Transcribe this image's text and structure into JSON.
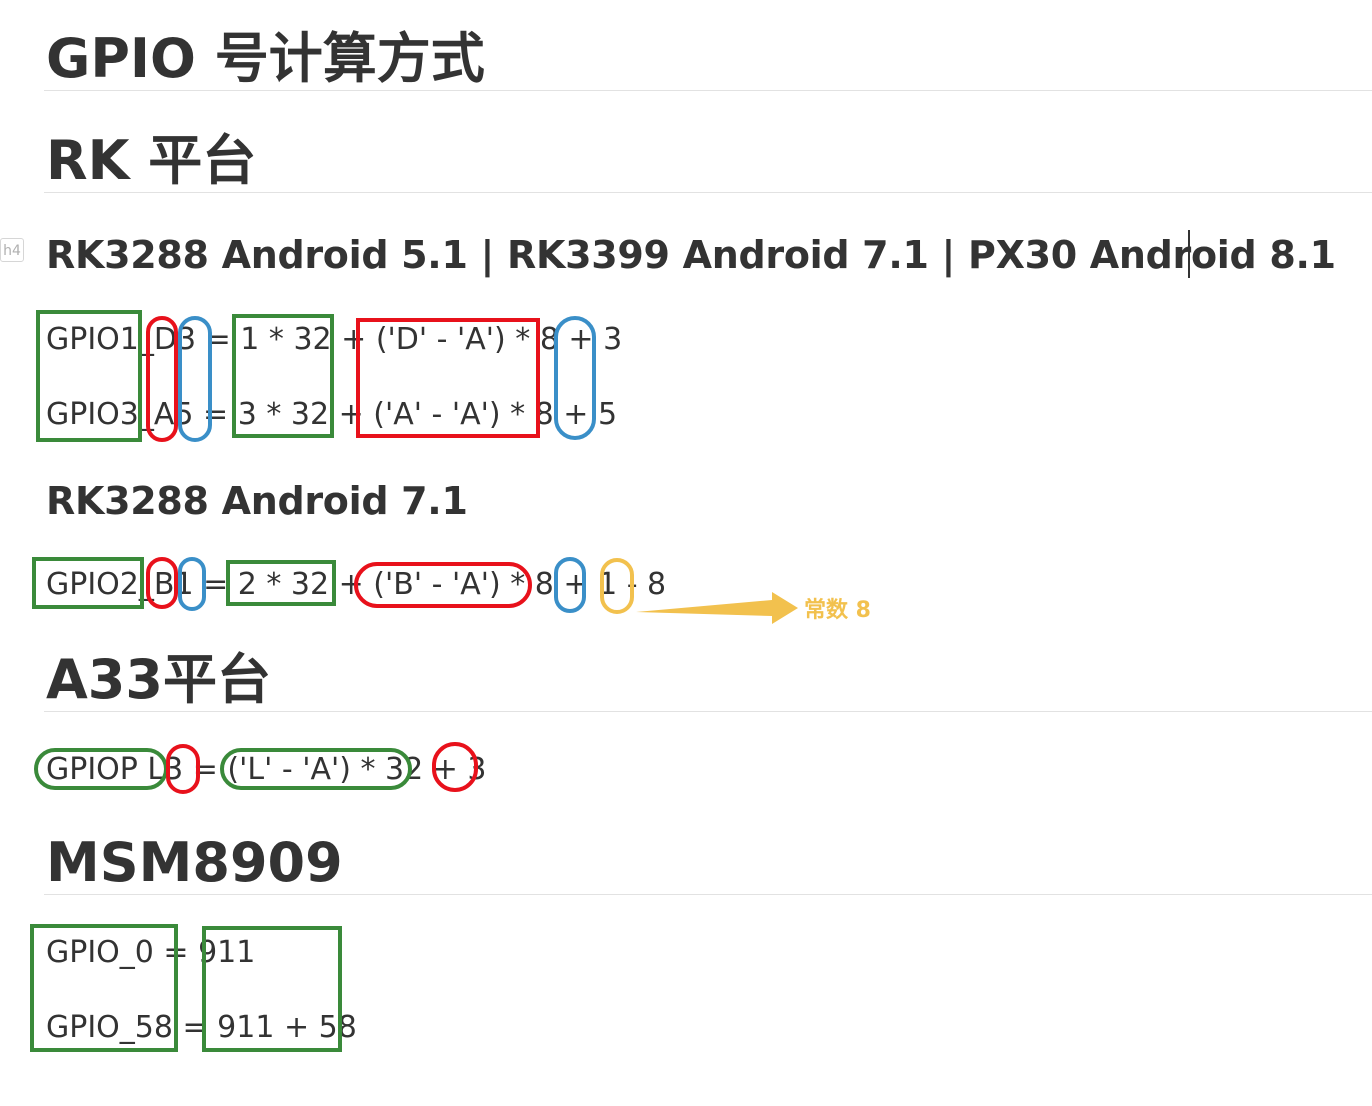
{
  "title": "GPIO 号计算方式",
  "sections": {
    "rk": {
      "heading": "RK 平台",
      "tag": "h4",
      "sub1": {
        "heading": "RK3288 Android 5.1 | RK3399 Android 7.1 | PX30 Android 8.1",
        "line1": "GPIO1_D3 = 1 * 32 + ('D' - 'A') * 8 + 3",
        "line2": "GPIO3_A5 = 3 * 32 + ('A' - 'A') * 8 + 5"
      },
      "sub2": {
        "heading": "RK3288 Android 7.1",
        "line1": "GPIO2_B1 = 2 * 32 + ('B' - 'A') * 8 + 1 - 8",
        "note": "常数 8"
      }
    },
    "a33": {
      "heading": "A33平台",
      "line1": "GPIOP L3 = ('L' - 'A') * 32 + 3"
    },
    "msm": {
      "heading": "MSM8909",
      "line1": "GPIO_0   = 911",
      "line2": "GPIO_58 = 911 + 58"
    }
  },
  "colors": {
    "green": "#3a8a3a",
    "red": "#e8111b",
    "blue": "#3a8fc8",
    "yellow": "#f2c14e",
    "text": "#333333"
  }
}
